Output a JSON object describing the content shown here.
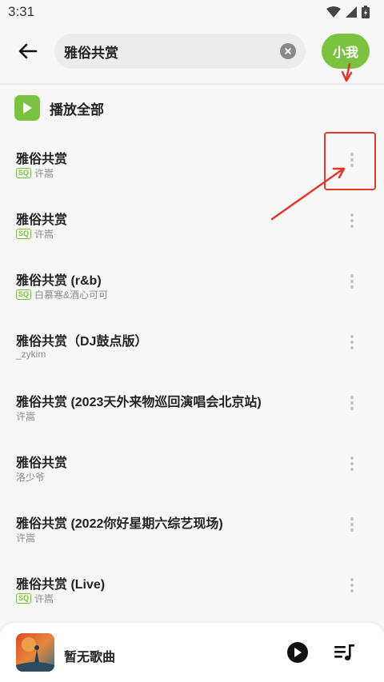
{
  "status": {
    "time": "3:31"
  },
  "search": {
    "query": "雅俗共赏",
    "button_label": "小我"
  },
  "play_all": {
    "label": "播放全部"
  },
  "songs": [
    {
      "title": "雅俗共赏",
      "artist": "许嵩",
      "sq": true
    },
    {
      "title": "雅俗共赏",
      "artist": "许嵩",
      "sq": true
    },
    {
      "title": "雅俗共赏 (r&b)",
      "artist": "白慕寒&酒心可可",
      "sq": true
    },
    {
      "title": "雅俗共赏（DJ鼓点版）",
      "artist": "_zykim",
      "sq": false
    },
    {
      "title": "雅俗共赏 (2023天外来物巡回演唱会北京站)",
      "artist": "许嵩",
      "sq": false
    },
    {
      "title": "雅俗共赏",
      "artist": "洛少爷",
      "sq": false
    },
    {
      "title": "雅俗共赏 (2022你好星期六综艺现场)",
      "artist": "许嵩",
      "sq": false
    },
    {
      "title": "雅俗共赏 (Live)",
      "artist": "许嵩",
      "sq": true
    }
  ],
  "badge": {
    "sq_label": "SQ"
  },
  "player": {
    "title": "暂无歌曲"
  },
  "colors": {
    "accent": "#7cc242",
    "annotation": "#e0392b"
  }
}
